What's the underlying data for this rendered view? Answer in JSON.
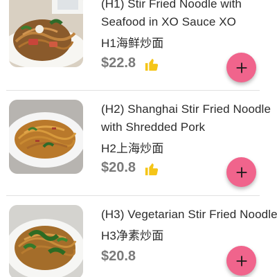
{
  "menu": {
    "items": [
      {
        "title_lines": [
          "(H1) Stir Fried Noodle with",
          "Seafood in XO Sauce XO",
          "H1海鲜炒面"
        ],
        "price": "$22.8",
        "liked": true,
        "image_icon": "noodle-dish-photo"
      },
      {
        "title_lines": [
          "(H2) Shanghai Stir Fried Noodle",
          "with Shredded Pork",
          "H2上海炒面"
        ],
        "price": "$20.8",
        "liked": true,
        "image_icon": "noodle-dish-photo"
      },
      {
        "title_lines": [
          "(H3) Vegetarian Stir Fried Noodle",
          "H3净素炒面"
        ],
        "price": "$20.8",
        "liked": false,
        "image_icon": "noodle-dish-photo"
      }
    ]
  },
  "icons": {
    "like": "thumbs-up-icon",
    "add": "plus-icon"
  },
  "colors": {
    "add_button": "#f0648c",
    "like_icon": "#f5c518",
    "price": "#7a7a7a",
    "title": "#2b2b2b"
  }
}
